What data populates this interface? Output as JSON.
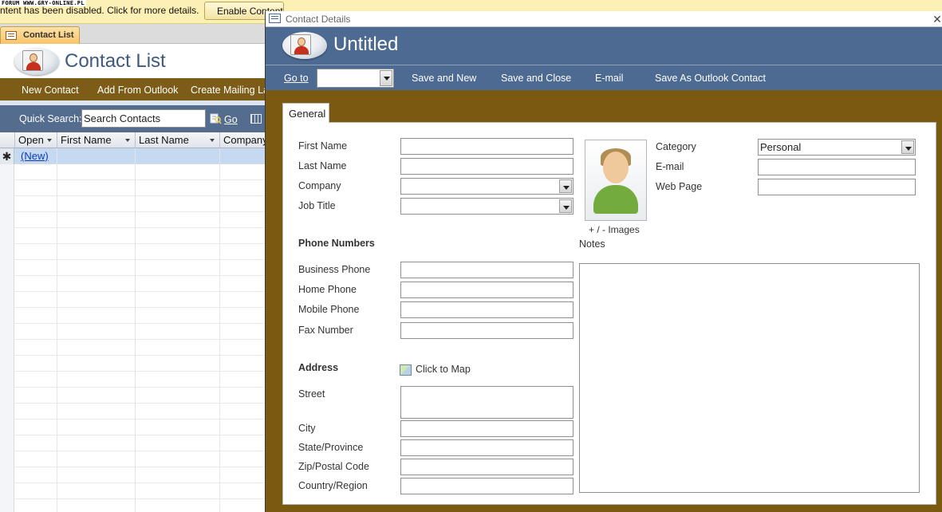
{
  "watermark": "FORUM WWW.GRY-ONLINE.PL",
  "message_bar": {
    "text": "ntent has been disabled. Click for more details.",
    "button_label": "Enable Content"
  },
  "document_tab": {
    "label": "Contact List"
  },
  "contact_list": {
    "title": "Contact List",
    "toolbar": {
      "new_contact": "New Contact",
      "add_from_outlook": "Add From Outlook",
      "create_mailing_labels": "Create Mailing Labels"
    },
    "quick_search": {
      "label": "Quick Search:",
      "value": "Search Contacts",
      "go_label": "Go"
    },
    "columns": [
      "Open",
      "First Name",
      "Last Name",
      "Company"
    ],
    "new_row_marker": "✱",
    "new_row_link": "(New)"
  },
  "dialog": {
    "window_title": "Contact Details",
    "close_glyph": "✕",
    "heading": "Untitled",
    "toolbar": {
      "goto_label": "Go to",
      "goto_value": "",
      "save_and_new": "Save and New",
      "save_and_close": "Save and Close",
      "email": "E-mail",
      "save_as_outlook": "Save As Outlook Contact"
    },
    "tab_label": "General",
    "fields": {
      "first_name": {
        "label": "First Name",
        "value": ""
      },
      "last_name": {
        "label": "Last Name",
        "value": ""
      },
      "company": {
        "label": "Company",
        "value": ""
      },
      "job_title": {
        "label": "Job Title",
        "value": ""
      },
      "category": {
        "label": "Category",
        "value": "Personal"
      },
      "email": {
        "label": "E-mail",
        "value": ""
      },
      "web_page": {
        "label": "Web Page",
        "value": ""
      }
    },
    "images_label": "+ / -  Images",
    "phone_section": {
      "heading": "Phone Numbers",
      "business_phone": "Business Phone",
      "home_phone": "Home Phone",
      "mobile_phone": "Mobile Phone",
      "fax_number": "Fax Number"
    },
    "notes_label": "Notes",
    "address_section": {
      "heading": "Address",
      "click_to_map": "Click to Map",
      "street": "Street",
      "city": "City",
      "state_province": "State/Province",
      "zip_postal": "Zip/Postal Code",
      "country_region": "Country/Region"
    }
  }
}
